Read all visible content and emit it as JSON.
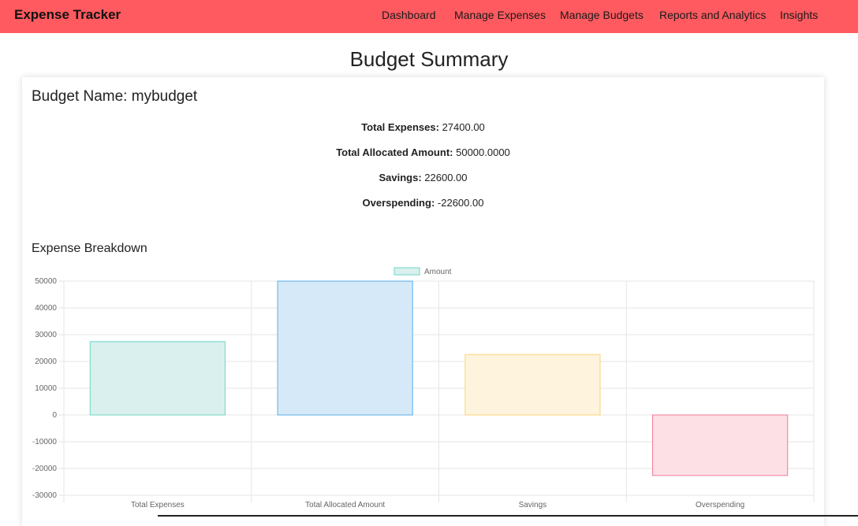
{
  "nav": {
    "brand": "Expense Tracker",
    "links": [
      "Dashboard",
      "Manage Expenses",
      "Manage Budgets",
      "Reports and Analytics",
      "Insights"
    ]
  },
  "page_title": "Budget Summary",
  "budget": {
    "name_label": "Budget Name: mybudget",
    "stats": [
      {
        "label": "Total Expenses:",
        "value": "27400.00"
      },
      {
        "label": "Total Allocated Amount:",
        "value": "50000.0000"
      },
      {
        "label": "Savings:",
        "value": "22600.00"
      },
      {
        "label": "Overspending:",
        "value": "-22600.00"
      }
    ]
  },
  "breakdown_title": "Expense Breakdown",
  "colors": {
    "navbar": "#ff5a5f",
    "bars_fill": [
      "#d9f0ef",
      "#d6e9f8",
      "#fef3dc",
      "#fde0e6"
    ],
    "bars_stroke": [
      "#6fd6c0",
      "#5aaee6",
      "#f9d57a",
      "#f07a96"
    ]
  },
  "chart_data": {
    "type": "bar",
    "categories": [
      "Total Expenses",
      "Total Allocated Amount",
      "Savings",
      "Overspending"
    ],
    "series": [
      {
        "name": "Amount",
        "values": [
          27400,
          50000,
          22600,
          -22600
        ]
      }
    ],
    "ylim": [
      -30000,
      50000
    ],
    "yticks": [
      "50000",
      "40000",
      "30000",
      "20000",
      "10000",
      "0",
      "-10000",
      "-20000",
      "-30000"
    ],
    "legend_position": "top",
    "grid": true
  }
}
